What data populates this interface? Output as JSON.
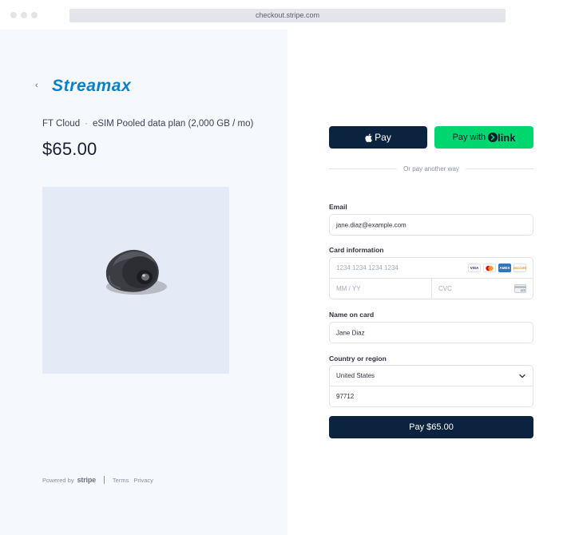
{
  "browser": {
    "url": "checkout.stripe.com"
  },
  "merchant": {
    "back_icon": "chevron-left-icon",
    "logo_text": "Streamax",
    "brand_color": "#0a7fc9"
  },
  "product": {
    "name": "FT Cloud",
    "separator": "·",
    "description": "eSIM Pooled data plan (2,000 GB / mo)",
    "price": "$65.00"
  },
  "footer": {
    "powered_by": "Powered by",
    "stripe": "stripe",
    "terms": "Terms",
    "privacy": "Privacy"
  },
  "wallet": {
    "apple_pay_label": "Pay",
    "link_pay_label": "Pay with",
    "link_word": "link",
    "divider_text": "Or pay another way"
  },
  "form": {
    "email_label": "Email",
    "email_value": "jane.diaz@example.com",
    "card_label": "Card information",
    "card_number_placeholder": "1234 1234 1234 1234",
    "expiry_placeholder": "MM / YY",
    "cvc_placeholder": "CVC",
    "card_brands": [
      "VISA",
      "MC",
      "AMEX",
      "DISCOVER"
    ],
    "name_label": "Name on card",
    "name_value": "Jane Diaz",
    "country_label": "Country or region",
    "country_value": "United States",
    "zip_value": "97712"
  },
  "submit": {
    "label": "Pay $65.00"
  },
  "colors": {
    "left_bg": "#f5f8fc",
    "button_navy": "#0c2340",
    "link_green": "#00d66f"
  }
}
